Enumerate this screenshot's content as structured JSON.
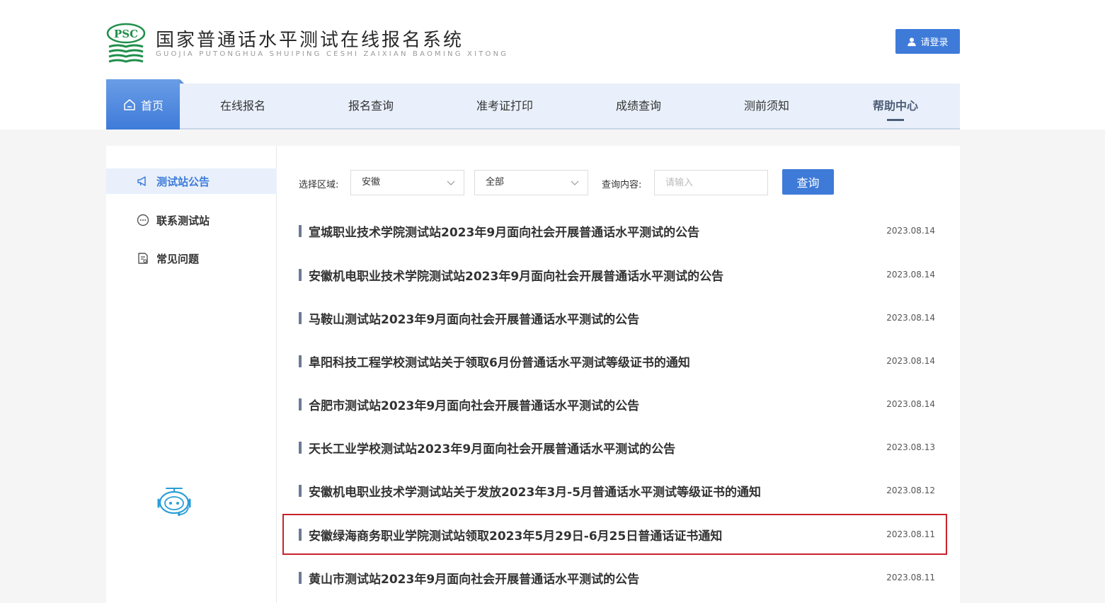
{
  "header": {
    "logo_mark_text": "PSC",
    "title": "国家普通话水平测试在线报名系统",
    "subtitle": "GUOJIA PUTONGHUA SHUIPING CESHI ZAIXIAN BAOMING XITONG",
    "login_label": "请登录",
    "login_icon": "user-icon"
  },
  "nav": {
    "home_label": "首页",
    "home_icon": "home-icon",
    "items": [
      {
        "label": "在线报名"
      },
      {
        "label": "报名查询"
      },
      {
        "label": "准考证打印"
      },
      {
        "label": "成绩查询"
      },
      {
        "label": "测前须知"
      },
      {
        "label": "帮助中心",
        "active": true
      }
    ]
  },
  "sidebar": {
    "items": [
      {
        "label": "测试站公告",
        "icon": "megaphone-icon",
        "active": true
      },
      {
        "label": "联系测试站",
        "icon": "chat-icon"
      },
      {
        "label": "常见问题",
        "icon": "document-icon"
      }
    ],
    "robot_icon": "robot-assistant-icon"
  },
  "filter": {
    "region_label": "选择区域:",
    "province_value": "安徽",
    "city_value": "全部",
    "query_label": "查询内容:",
    "query_placeholder": "请输入",
    "query_button": "查询"
  },
  "notices": [
    {
      "title": "宣城职业技术学院测试站2023年9月面向社会开展普通话水平测试的公告",
      "date": "2023.08.14"
    },
    {
      "title": "安徽机电职业技术学院测试站2023年9月面向社会开展普通话水平测试的公告",
      "date": "2023.08.14"
    },
    {
      "title": "马鞍山测试站2023年9月面向社会开展普通话水平测试的公告",
      "date": "2023.08.14"
    },
    {
      "title": "阜阳科技工程学校测试站关于领取6月份普通话水平测试等级证书的通知",
      "date": "2023.08.14"
    },
    {
      "title": "合肥市测试站2023年9月面向社会开展普通话水平测试的公告",
      "date": "2023.08.14"
    },
    {
      "title": "天长工业学校测试站2023年9月面向社会开展普通话水平测试的公告",
      "date": "2023.08.13"
    },
    {
      "title": "安徽机电职业技术学测试站关于发放2023年3月-5月普通话水平测试等级证书的通知",
      "date": "2023.08.12"
    },
    {
      "title": "安徽绿海商务职业学院测试站领取2023年5月29日-6月25日普通话证书通知",
      "date": "2023.08.11",
      "highlighted": true
    },
    {
      "title": "黄山市测试站2023年9月面向社会开展普通话水平测试的公告",
      "date": "2023.08.11"
    }
  ],
  "colors": {
    "accent": "#3e7bd9",
    "nav_bg": "#e9f0fb",
    "highlight_border": "#c8232c",
    "logo_green": "#1f8f4a"
  }
}
